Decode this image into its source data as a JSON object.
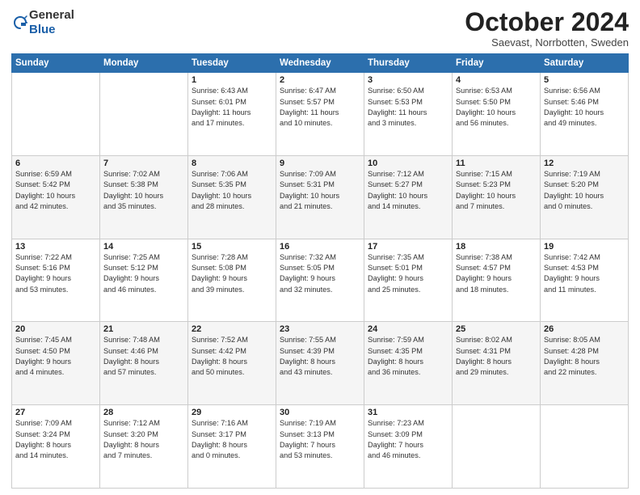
{
  "header": {
    "logo_general": "General",
    "logo_blue": "Blue",
    "month_title": "October 2024",
    "subtitle": "Saevast, Norrbotten, Sweden"
  },
  "weekdays": [
    "Sunday",
    "Monday",
    "Tuesday",
    "Wednesday",
    "Thursday",
    "Friday",
    "Saturday"
  ],
  "weeks": [
    [
      {
        "day": "",
        "info": ""
      },
      {
        "day": "",
        "info": ""
      },
      {
        "day": "1",
        "info": "Sunrise: 6:43 AM\nSunset: 6:01 PM\nDaylight: 11 hours\nand 17 minutes."
      },
      {
        "day": "2",
        "info": "Sunrise: 6:47 AM\nSunset: 5:57 PM\nDaylight: 11 hours\nand 10 minutes."
      },
      {
        "day": "3",
        "info": "Sunrise: 6:50 AM\nSunset: 5:53 PM\nDaylight: 11 hours\nand 3 minutes."
      },
      {
        "day": "4",
        "info": "Sunrise: 6:53 AM\nSunset: 5:50 PM\nDaylight: 10 hours\nand 56 minutes."
      },
      {
        "day": "5",
        "info": "Sunrise: 6:56 AM\nSunset: 5:46 PM\nDaylight: 10 hours\nand 49 minutes."
      }
    ],
    [
      {
        "day": "6",
        "info": "Sunrise: 6:59 AM\nSunset: 5:42 PM\nDaylight: 10 hours\nand 42 minutes."
      },
      {
        "day": "7",
        "info": "Sunrise: 7:02 AM\nSunset: 5:38 PM\nDaylight: 10 hours\nand 35 minutes."
      },
      {
        "day": "8",
        "info": "Sunrise: 7:06 AM\nSunset: 5:35 PM\nDaylight: 10 hours\nand 28 minutes."
      },
      {
        "day": "9",
        "info": "Sunrise: 7:09 AM\nSunset: 5:31 PM\nDaylight: 10 hours\nand 21 minutes."
      },
      {
        "day": "10",
        "info": "Sunrise: 7:12 AM\nSunset: 5:27 PM\nDaylight: 10 hours\nand 14 minutes."
      },
      {
        "day": "11",
        "info": "Sunrise: 7:15 AM\nSunset: 5:23 PM\nDaylight: 10 hours\nand 7 minutes."
      },
      {
        "day": "12",
        "info": "Sunrise: 7:19 AM\nSunset: 5:20 PM\nDaylight: 10 hours\nand 0 minutes."
      }
    ],
    [
      {
        "day": "13",
        "info": "Sunrise: 7:22 AM\nSunset: 5:16 PM\nDaylight: 9 hours\nand 53 minutes."
      },
      {
        "day": "14",
        "info": "Sunrise: 7:25 AM\nSunset: 5:12 PM\nDaylight: 9 hours\nand 46 minutes."
      },
      {
        "day": "15",
        "info": "Sunrise: 7:28 AM\nSunset: 5:08 PM\nDaylight: 9 hours\nand 39 minutes."
      },
      {
        "day": "16",
        "info": "Sunrise: 7:32 AM\nSunset: 5:05 PM\nDaylight: 9 hours\nand 32 minutes."
      },
      {
        "day": "17",
        "info": "Sunrise: 7:35 AM\nSunset: 5:01 PM\nDaylight: 9 hours\nand 25 minutes."
      },
      {
        "day": "18",
        "info": "Sunrise: 7:38 AM\nSunset: 4:57 PM\nDaylight: 9 hours\nand 18 minutes."
      },
      {
        "day": "19",
        "info": "Sunrise: 7:42 AM\nSunset: 4:53 PM\nDaylight: 9 hours\nand 11 minutes."
      }
    ],
    [
      {
        "day": "20",
        "info": "Sunrise: 7:45 AM\nSunset: 4:50 PM\nDaylight: 9 hours\nand 4 minutes."
      },
      {
        "day": "21",
        "info": "Sunrise: 7:48 AM\nSunset: 4:46 PM\nDaylight: 8 hours\nand 57 minutes."
      },
      {
        "day": "22",
        "info": "Sunrise: 7:52 AM\nSunset: 4:42 PM\nDaylight: 8 hours\nand 50 minutes."
      },
      {
        "day": "23",
        "info": "Sunrise: 7:55 AM\nSunset: 4:39 PM\nDaylight: 8 hours\nand 43 minutes."
      },
      {
        "day": "24",
        "info": "Sunrise: 7:59 AM\nSunset: 4:35 PM\nDaylight: 8 hours\nand 36 minutes."
      },
      {
        "day": "25",
        "info": "Sunrise: 8:02 AM\nSunset: 4:31 PM\nDaylight: 8 hours\nand 29 minutes."
      },
      {
        "day": "26",
        "info": "Sunrise: 8:05 AM\nSunset: 4:28 PM\nDaylight: 8 hours\nand 22 minutes."
      }
    ],
    [
      {
        "day": "27",
        "info": "Sunrise: 7:09 AM\nSunset: 3:24 PM\nDaylight: 8 hours\nand 14 minutes."
      },
      {
        "day": "28",
        "info": "Sunrise: 7:12 AM\nSunset: 3:20 PM\nDaylight: 8 hours\nand 7 minutes."
      },
      {
        "day": "29",
        "info": "Sunrise: 7:16 AM\nSunset: 3:17 PM\nDaylight: 8 hours\nand 0 minutes."
      },
      {
        "day": "30",
        "info": "Sunrise: 7:19 AM\nSunset: 3:13 PM\nDaylight: 7 hours\nand 53 minutes."
      },
      {
        "day": "31",
        "info": "Sunrise: 7:23 AM\nSunset: 3:09 PM\nDaylight: 7 hours\nand 46 minutes."
      },
      {
        "day": "",
        "info": ""
      },
      {
        "day": "",
        "info": ""
      }
    ]
  ]
}
